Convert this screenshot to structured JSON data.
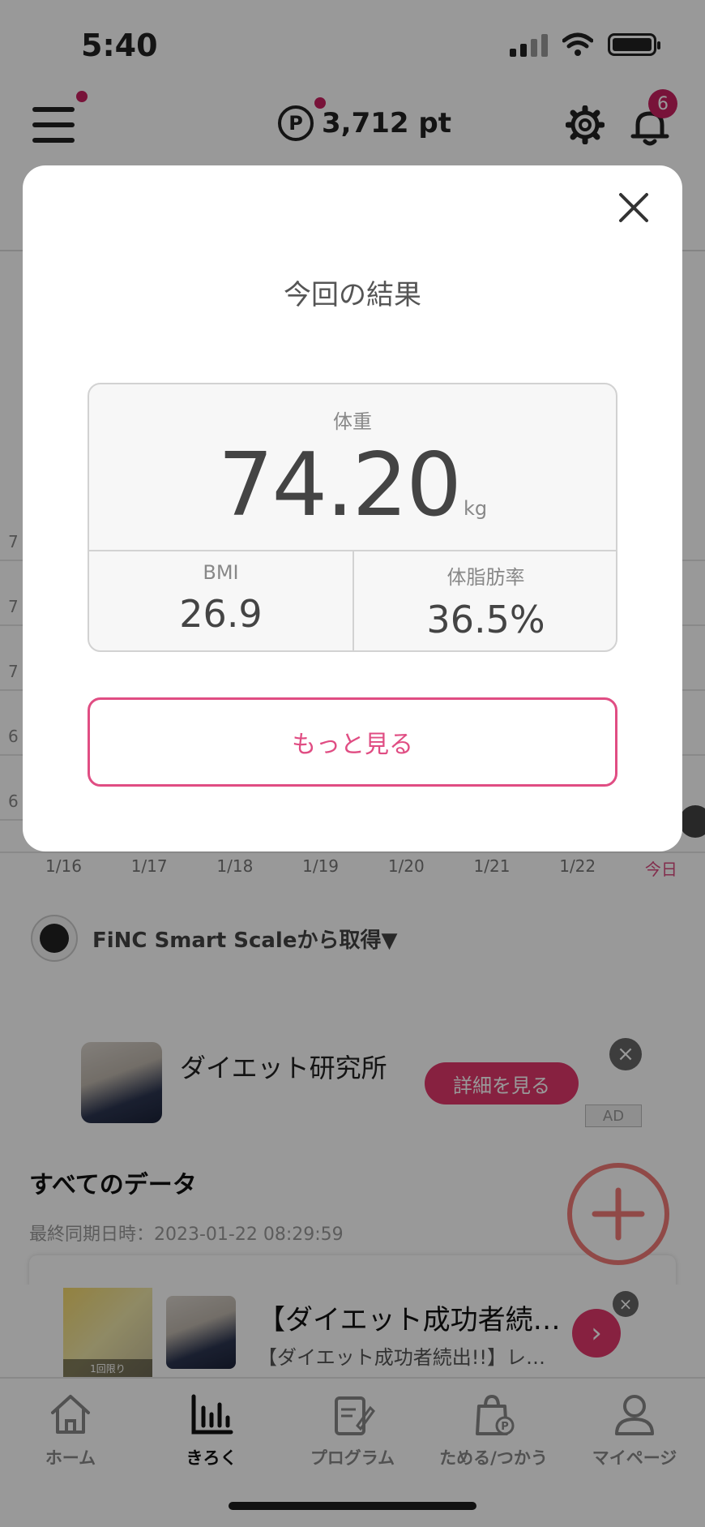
{
  "status_bar": {
    "time": "5:40"
  },
  "header": {
    "points": "3,712 pt",
    "notification_count": "6"
  },
  "chart": {
    "y_labels": [
      "7",
      "7",
      "7",
      "6",
      "6"
    ],
    "x_labels": [
      "1/16",
      "1/17",
      "1/18",
      "1/19",
      "1/20",
      "1/21",
      "1/22",
      "今日"
    ]
  },
  "source": {
    "label": "FiNC Smart Scaleから取得▼"
  },
  "ad_card": {
    "title": "ダイエット研究所",
    "cta": "詳細を見る",
    "badge": "AD"
  },
  "all_data": {
    "title": "すべてのデータ",
    "last_sync": "最終同期日時：2023-01-22 08:29:59"
  },
  "bottom_ad": {
    "title": "【ダイエット成功者続…",
    "subtitle": "【ダイエット成功者続出!!】レ…",
    "image_caption": "1回限り"
  },
  "tab_bar": {
    "tabs": [
      {
        "label": "ホーム"
      },
      {
        "label": "きろく"
      },
      {
        "label": "プログラム"
      },
      {
        "label": "ためる/つかう"
      },
      {
        "label": "マイページ"
      }
    ]
  },
  "modal": {
    "title": "今回の結果",
    "weight_label": "体重",
    "weight_value": "74.20",
    "weight_unit": "kg",
    "bmi_label": "BMI",
    "bmi_value": "26.9",
    "body_fat_label": "体脂肪率",
    "body_fat_value": "36.5%",
    "more_button": "もっと見る"
  },
  "colors": {
    "accent": "#e04d83",
    "badge": "#c9205f",
    "fab_ring": "#f07b77"
  }
}
